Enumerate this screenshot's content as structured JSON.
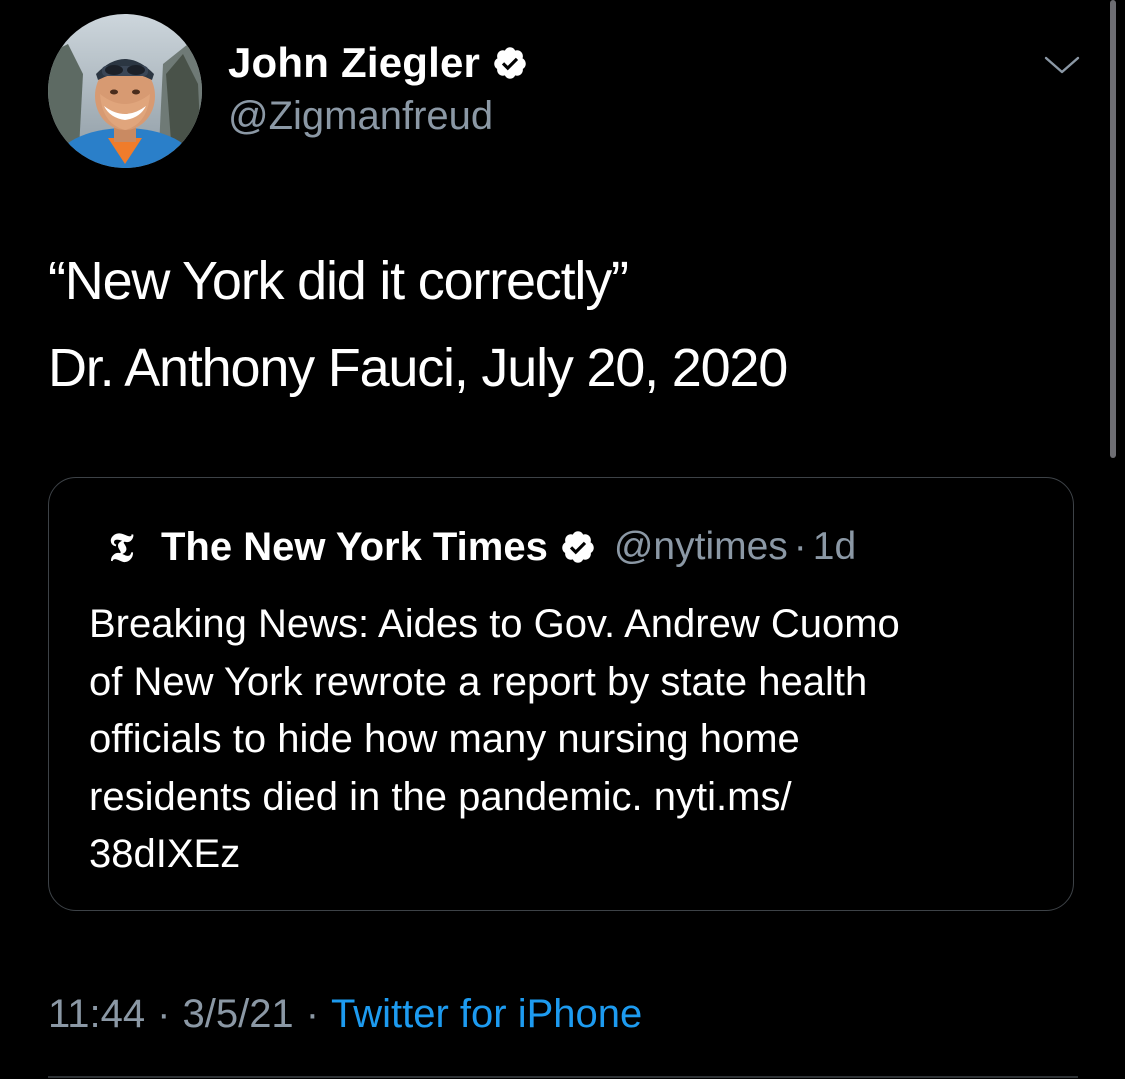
{
  "tweet": {
    "author": {
      "display_name": "John Ziegler",
      "handle": "@Zigmanfreud",
      "verified_icon": "verified-badge-icon"
    },
    "menu_icon": "chevron-down-icon",
    "text_lines": [
      "“New York did it correctly”",
      "Dr. Anthony Fauci, July 20, 2020"
    ],
    "quoted": {
      "logo_glyph": "𝕿",
      "logo_icon": "nyt-logo-icon",
      "display_name": "The New York Times",
      "handle": "@nytimes",
      "separator": "·",
      "time": "1d",
      "body_lines": [
        "Breaking News: Aides to Gov. Andrew Cuomo",
        "of New York rewrote a report by state health",
        "officials to hide how many nursing home",
        "residents died in the pandemic. nyti.ms/",
        "38dIXEz"
      ]
    },
    "meta": {
      "time": "11:44",
      "date": "3/5/21",
      "separator": "·",
      "source": "Twitter for iPhone"
    }
  },
  "colors": {
    "background": "#000000",
    "primary_text": "#ffffff",
    "secondary_text": "#8b98a5",
    "link": "#1d9bf0",
    "border": "#3d4247"
  }
}
